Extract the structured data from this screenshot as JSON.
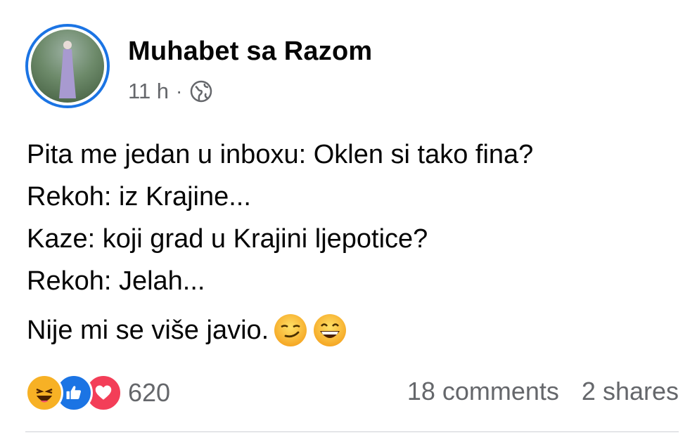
{
  "post": {
    "author": "Muhabet sa Razom",
    "time": "11 h",
    "separator": "·",
    "audience_icon": "globe-icon",
    "lines": [
      "Pita me jedan u inboxu: Oklen si tako fina?",
      "Rekoh: iz Krajine...",
      "Kaze: koji grad u Krajini ljepotice?",
      "Rekoh: Jelah..."
    ],
    "last_line": "Nije mi se više javio.",
    "last_line_emojis": [
      "smirking-face-emoji",
      "grinning-face-emoji"
    ]
  },
  "footer": {
    "reaction_icons": [
      "haha-reaction-icon",
      "like-reaction-icon",
      "love-reaction-icon"
    ],
    "reaction_count": "620",
    "comments": "18 comments",
    "shares": "2 shares"
  },
  "colors": {
    "accent": "#1b74e4",
    "secondary_text": "#65676b",
    "primary_text": "#050505",
    "love": "#f33e58",
    "haha": "#f7b125"
  }
}
